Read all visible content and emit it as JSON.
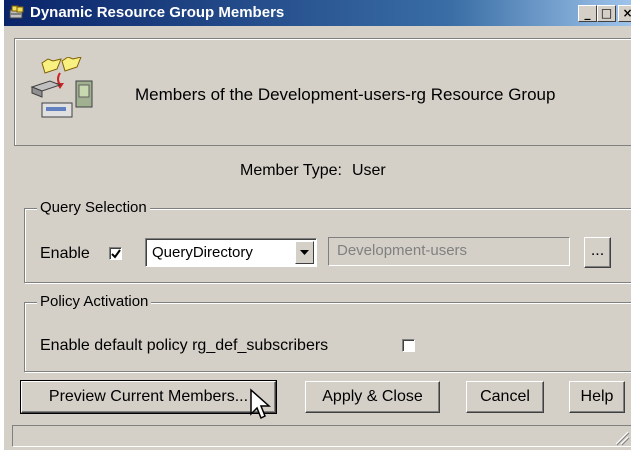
{
  "window": {
    "title": "Dynamic Resource Group Members",
    "minimize_glyph": "_",
    "maximize_glyph": "□",
    "close_glyph": "×"
  },
  "header": {
    "icon": "resource-group-members-icon",
    "text": "Members of the Development-users-rg Resource Group"
  },
  "member_type": {
    "label": "Member Type:",
    "value": "User"
  },
  "query_selection": {
    "legend": "Query Selection",
    "enable_label": "Enable",
    "enable_checked": true,
    "query_type": "QueryDirectory",
    "query_value": "Development-users",
    "browse_label": "..."
  },
  "policy_activation": {
    "legend": "Policy Activation",
    "enable_default_label": "Enable default policy rg_def_subscribers",
    "enable_default_checked": false
  },
  "buttons": {
    "preview": "Preview Current Members...",
    "apply_close": "Apply & Close",
    "cancel": "Cancel",
    "help": "Help"
  },
  "status": {
    "text": ""
  }
}
